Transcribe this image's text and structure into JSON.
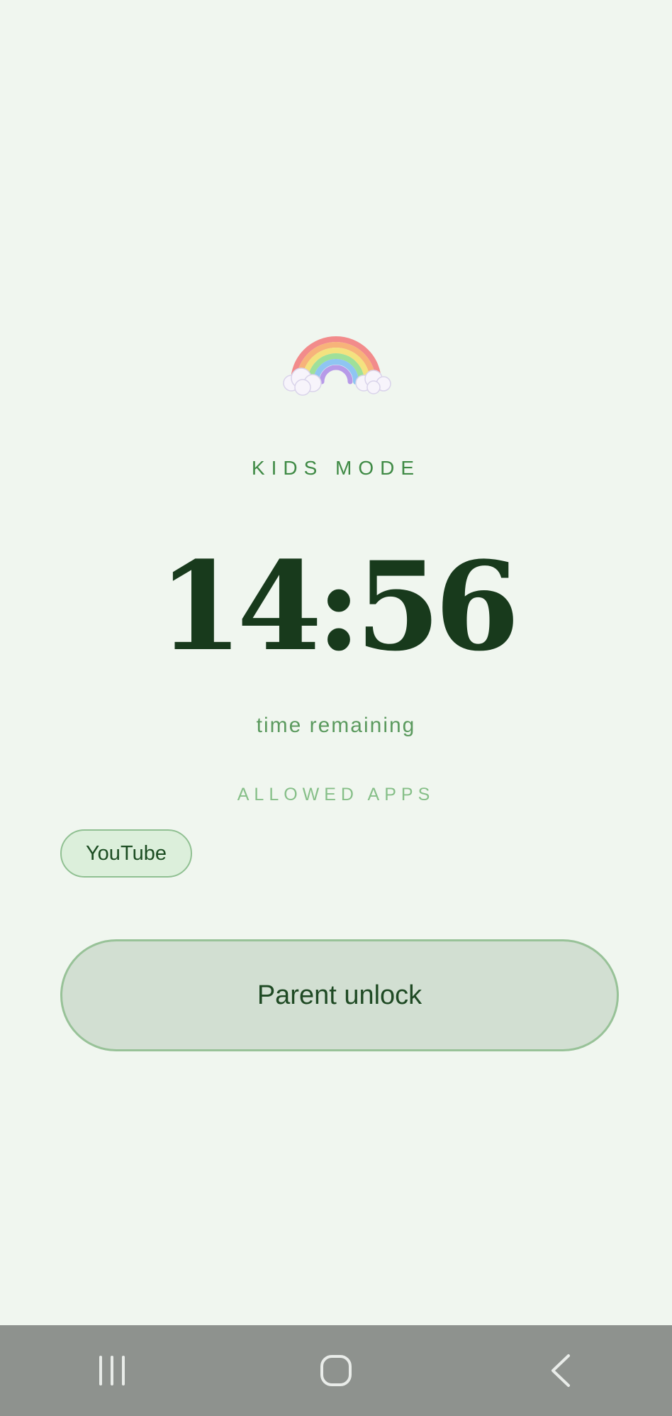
{
  "hero": {
    "icon": "rainbow-icon"
  },
  "mode": {
    "label": "KIDS MODE"
  },
  "timer": {
    "value": "14:56",
    "caption": "time remaining"
  },
  "allowed_apps": {
    "label": "ALLOWED APPS",
    "apps": [
      "YouTube"
    ]
  },
  "unlock": {
    "label": "Parent unlock"
  },
  "navbar": {
    "items": [
      {
        "icon": "recent-apps-icon"
      },
      {
        "icon": "home-icon"
      },
      {
        "icon": "back-icon"
      }
    ]
  },
  "colors": {
    "background": "#f0f6ef",
    "accent": "#3f8a45",
    "time": "#183a1c",
    "button": "#d2dfd2",
    "navbar": "#8e928e"
  }
}
